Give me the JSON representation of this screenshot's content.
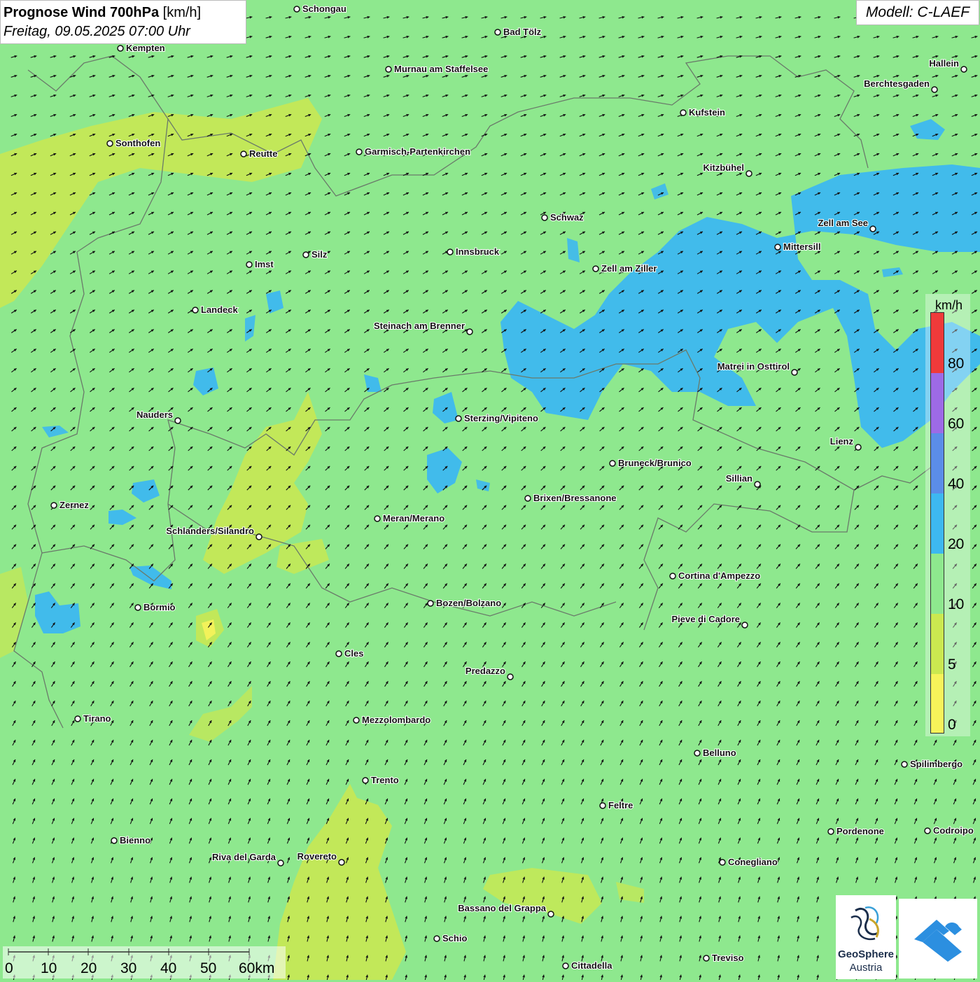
{
  "header": {
    "title_bold": "Prognose Wind 700hPa",
    "title_unit": "[km/h]",
    "datetime": "Freitag, 09.05.2025 07:00 Uhr",
    "model": "Modell: C-LAEF"
  },
  "legend": {
    "unit": "km/h",
    "labels": [
      "80",
      "60",
      "40",
      "20",
      "10",
      "5",
      "0"
    ],
    "colors": {
      "over80": "#b8e0f5",
      "c60_80": "#ef3a3a",
      "c40_60": "#9d6ae6",
      "c20_40": "#5b8de8",
      "c10_20": "#3db8f0",
      "c5_10": "#8ee88e",
      "c0_5a": "#cbe850",
      "c0_5b": "#f7f35a"
    }
  },
  "scalebar": {
    "labels": [
      "0",
      "10",
      "20",
      "30",
      "40",
      "50",
      "60km"
    ]
  },
  "logos": {
    "geosphere_name": "GeoSphere",
    "geosphere_sub": "Austria"
  },
  "cities": [
    {
      "name": "Schongau"
    },
    {
      "name": "Bad Tölz"
    },
    {
      "name": "Kempten"
    },
    {
      "name": "Murnau am Staffelsee"
    },
    {
      "name": "Hallein"
    },
    {
      "name": "Berchtesgaden"
    },
    {
      "name": "Kufstein"
    },
    {
      "name": "Sonthofen"
    },
    {
      "name": "Reutte"
    },
    {
      "name": "Garmisch-Partenkirchen"
    },
    {
      "name": "Kitzbühel"
    },
    {
      "name": "Schwaz"
    },
    {
      "name": "Zell am See"
    },
    {
      "name": "Mittersill"
    },
    {
      "name": "Innsbruck"
    },
    {
      "name": "Imst"
    },
    {
      "name": "Silz"
    },
    {
      "name": "Zell am Ziller"
    },
    {
      "name": "Landeck"
    },
    {
      "name": "Steinach am Brenner"
    },
    {
      "name": "Matrei in Osttirol"
    },
    {
      "name": "Nauders"
    },
    {
      "name": "Sterzing/Vipiteno"
    },
    {
      "name": "Lienz"
    },
    {
      "name": "Bruneck/Brunico"
    },
    {
      "name": "Sillian"
    },
    {
      "name": "Zernez"
    },
    {
      "name": "Brixen/Bressanone"
    },
    {
      "name": "Meran/Merano"
    },
    {
      "name": "Schlanders/Silandro"
    },
    {
      "name": "Cortina d'Ampezzo"
    },
    {
      "name": "Bormio"
    },
    {
      "name": "Bozen/Bolzano"
    },
    {
      "name": "Pieve di Cadore"
    },
    {
      "name": "Cles"
    },
    {
      "name": "Predazzo"
    },
    {
      "name": "Tirano"
    },
    {
      "name": "Mezzolombardo"
    },
    {
      "name": "Belluno"
    },
    {
      "name": "Spilimbergo"
    },
    {
      "name": "Trento"
    },
    {
      "name": "Feltre"
    },
    {
      "name": "Pordenone"
    },
    {
      "name": "Codroipo"
    },
    {
      "name": "Bienno"
    },
    {
      "name": "Riva del Garda"
    },
    {
      "name": "Rovereto"
    },
    {
      "name": "Conegliano"
    },
    {
      "name": "Bassano del Grappa"
    },
    {
      "name": "Schio"
    },
    {
      "name": "Treviso"
    },
    {
      "name": "Cittadella"
    }
  ]
}
